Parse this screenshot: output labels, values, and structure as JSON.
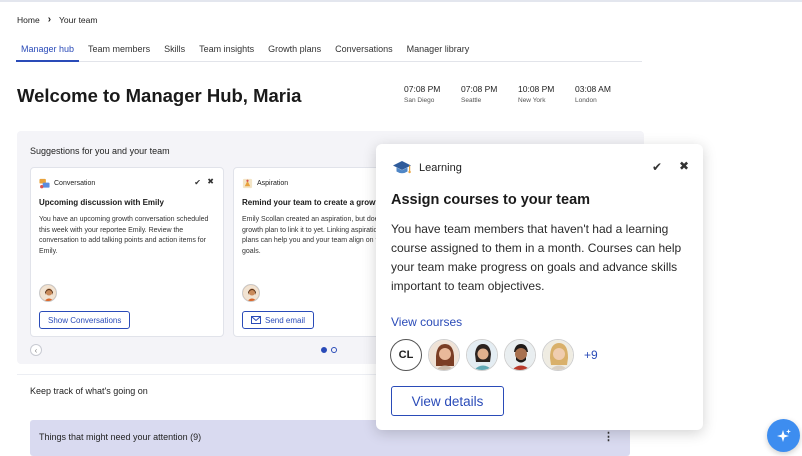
{
  "breadcrumb": {
    "home": "Home",
    "current": "Your team"
  },
  "tabs": [
    {
      "label": "Manager hub"
    },
    {
      "label": "Team members"
    },
    {
      "label": "Skills"
    },
    {
      "label": "Team insights"
    },
    {
      "label": "Growth plans"
    },
    {
      "label": "Conversations"
    },
    {
      "label": "Manager library"
    }
  ],
  "welcome": "Welcome to Manager Hub, Maria",
  "clocks": [
    {
      "time": "07:08 PM",
      "city": "San Diego"
    },
    {
      "time": "07:08 PM",
      "city": "Seattle"
    },
    {
      "time": "10:08 PM",
      "city": "New York"
    },
    {
      "time": "03:08 AM",
      "city": "London"
    }
  ],
  "suggestions": {
    "title": "Suggestions for you and your team",
    "cards": [
      {
        "category": "Conversation",
        "title": "Upcoming discussion with Emily",
        "body": "You have an upcoming growth conversation scheduled this week with your reportee Emily. Review the conversation to add talking points and action items for Emily.",
        "button": "Show Conversations"
      },
      {
        "category": "Aspiration",
        "title": "Remind your team to create a growth plan",
        "body": "Emily Scollan created an aspiration, but doesn't have a growth plan to link it to yet. Linking aspirations to growth plans can help you and your team align on their career goals.",
        "button": "Send email"
      }
    ],
    "pager_prev": "‹"
  },
  "track": {
    "title": "Keep track of what's going on",
    "attention": "Things that might need your attention (9)"
  },
  "popover": {
    "category": "Learning",
    "title": "Assign courses to your team",
    "body": "You have team members that haven't had a learning course assigned to them in a month. Courses can help your team make progress on goals and advance skills important to team objectives.",
    "link": "View courses",
    "initials": "CL",
    "more": "+9",
    "button": "View details"
  },
  "colors": {
    "accent": "#2a4bb8",
    "panel": "#f4f4f8",
    "attention": "#d9daf0",
    "fab": "#3d8df0"
  }
}
